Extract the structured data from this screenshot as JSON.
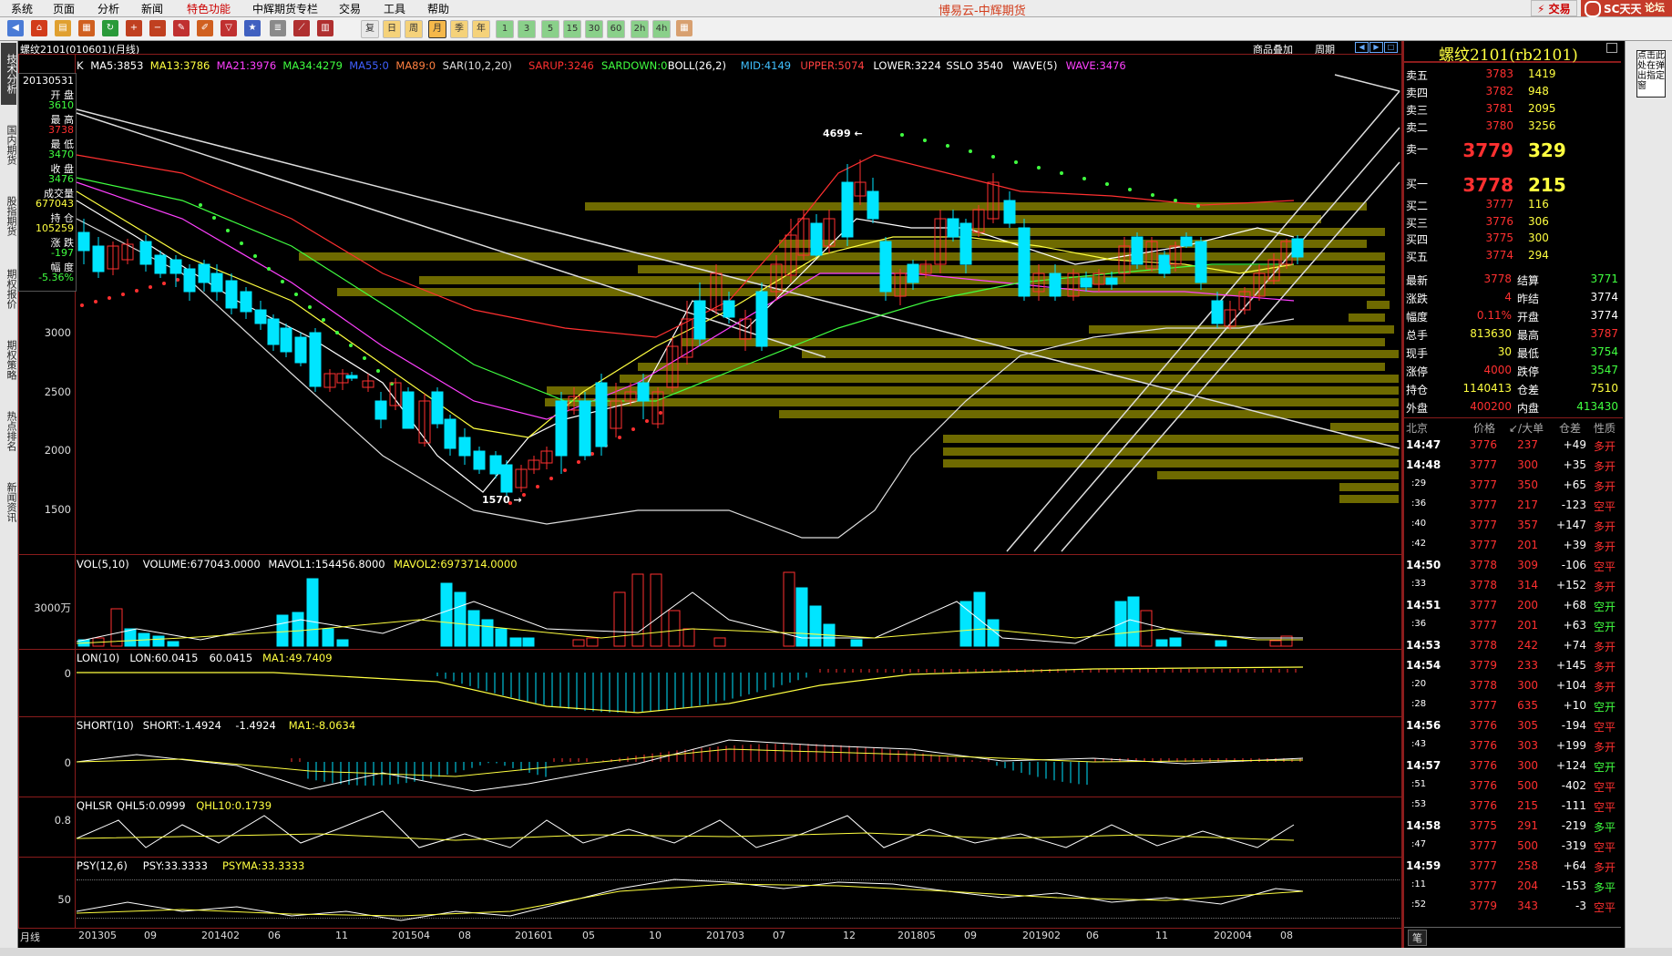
{
  "menu": {
    "items": [
      "系统",
      "页面",
      "分析",
      "新闻",
      "特色功能",
      "中辉期货专栏",
      "交易",
      "工具",
      "帮助"
    ],
    "title": "博易云-中辉期货",
    "trade_label": "交易",
    "brand": "论坛",
    "logo_text": "SC天天"
  },
  "toolbar": {
    "buttons": [
      "复",
      "日",
      "周",
      "月",
      "季",
      "年",
      "1",
      "3",
      "5",
      "15",
      "30",
      "60",
      "2h",
      "4h"
    ]
  },
  "sidebar": {
    "tabs": [
      "技术分析",
      "国内期货",
      "股指期货",
      "期权报价",
      "期权策略",
      "热点排名",
      "新闻资讯"
    ],
    "active": "技术分析"
  },
  "chart_header": {
    "symbol_line": "螺纹2101(010601)(月线)",
    "overlay_link": "商品叠加",
    "period_link": "周期"
  },
  "indicators": {
    "main": [
      {
        "text": "K",
        "color": "#ffffff"
      },
      {
        "text": "MA5:3853",
        "color": "#ffffff"
      },
      {
        "text": "MA13:3786",
        "color": "#ffff40"
      },
      {
        "text": "MA21:3976",
        "color": "#ff40ff"
      },
      {
        "text": "MA34:4279",
        "color": "#40ff40"
      },
      {
        "text": "MA55:0",
        "color": "#4060ff"
      },
      {
        "text": "MA89:0",
        "color": "#ff8040"
      },
      {
        "text": "SAR(10,2,20)",
        "color": "#dddddd"
      },
      {
        "text": "SARUP:3246",
        "color": "#ff3030"
      },
      {
        "text": "SARDOWN:0",
        "color": "#40ff40"
      },
      {
        "text": "BOLL(26,2)",
        "color": "#ffffff"
      },
      {
        "text": "MID:4149",
        "color": "#40c0ff"
      },
      {
        "text": "UPPER:5074",
        "color": "#ff4040"
      },
      {
        "text": "LOWER:3224",
        "color": "#ffffff"
      },
      {
        "text": "SSLO 3540",
        "color": "#ffffff"
      },
      {
        "text": "WAVE(5)",
        "color": "#ffffff"
      },
      {
        "text": "WAVE:3476",
        "color": "#ff40ff"
      }
    ],
    "vol": [
      {
        "text": "VOL(5,10)",
        "color": "#ffffff"
      },
      {
        "text": "VOLUME:677043.0000",
        "color": "#ffffff"
      },
      {
        "text": "MAVOL1:154456.8000",
        "color": "#ffffff"
      },
      {
        "text": "MAVOL2:6973714.0000",
        "color": "#ffff40"
      }
    ],
    "lon": [
      {
        "text": "LON(10)",
        "color": "#ffffff"
      },
      {
        "text": "LON:60.0415",
        "color": "#ffffff"
      },
      {
        "text": "60.0415",
        "color": "#ffffff"
      },
      {
        "text": "MA1:49.7409",
        "color": "#ffff40"
      }
    ],
    "short": [
      {
        "text": "SHORT(10)",
        "color": "#ffffff"
      },
      {
        "text": "SHORT:-1.4924",
        "color": "#ffffff"
      },
      {
        "text": "-1.4924",
        "color": "#ffffff"
      },
      {
        "text": "MA1:-8.0634",
        "color": "#ffff40"
      }
    ],
    "qhlsr": [
      {
        "text": "QHLSR",
        "color": "#ffffff"
      },
      {
        "text": "QHL5:0.0999",
        "color": "#ffffff"
      },
      {
        "text": "QHL10:0.1739",
        "color": "#ffff40"
      }
    ],
    "psy": [
      {
        "text": "PSY(12,6)",
        "color": "#ffffff"
      },
      {
        "text": "PSY:33.3333",
        "color": "#ffffff"
      },
      {
        "text": "PSYMA:33.3333",
        "color": "#ffff40"
      }
    ]
  },
  "infobox": {
    "date": "20130531",
    "open_label": "开 盘",
    "open": "3610",
    "high_label": "最 高",
    "high": "3738",
    "low_label": "最 低",
    "low": "3470",
    "close_label": "收 盘",
    "close": "3476",
    "vol_label": "成交量",
    "vol": "677043",
    "oi_label": "持 仓",
    "oi": "105259",
    "chg_label": "涨 跌",
    "chg": "-197",
    "amp_label": "幅 度",
    "amp": "-5.36%"
  },
  "y_labels": {
    "price": [
      "3000",
      "2500",
      "2000",
      "1500"
    ],
    "vol": "3000万",
    "lon": "0",
    "short": "0",
    "qhlsr": "0.8",
    "psy": "50"
  },
  "price_annotations": {
    "high": "4699",
    "low": "1570"
  },
  "x_labels": [
    "月线",
    "201305",
    "09",
    "201402",
    "06",
    "11",
    "201504",
    "08",
    "201601",
    "05",
    "10",
    "201703",
    "07",
    "12",
    "201805",
    "09",
    "201902",
    "06",
    "11",
    "202004",
    "08"
  ],
  "right_panel": {
    "title": "螺纹2101(rb2101)",
    "asks": [
      {
        "label": "卖五",
        "price": "3783",
        "vol": "1419"
      },
      {
        "label": "卖四",
        "price": "3782",
        "vol": "948"
      },
      {
        "label": "卖三",
        "price": "3781",
        "vol": "2095"
      },
      {
        "label": "卖二",
        "price": "3780",
        "vol": "3256"
      },
      {
        "label": "卖一",
        "price": "3779",
        "vol": "329"
      }
    ],
    "bids": [
      {
        "label": "买一",
        "price": "3778",
        "vol": "215"
      },
      {
        "label": "买二",
        "price": "3777",
        "vol": "116"
      },
      {
        "label": "买三",
        "price": "3776",
        "vol": "306"
      },
      {
        "label": "买四",
        "price": "3775",
        "vol": "300"
      },
      {
        "label": "买五",
        "price": "3774",
        "vol": "294"
      }
    ],
    "stats": [
      {
        "l1": "最新",
        "v1": "3778",
        "c1": "#ff3030",
        "l2": "结算",
        "v2": "3771",
        "c2": "#40ff40"
      },
      {
        "l1": "涨跌",
        "v1": "4",
        "c1": "#ff3030",
        "l2": "昨结",
        "v2": "3774",
        "c2": "#ffffff"
      },
      {
        "l1": "幅度",
        "v1": "0.11%",
        "c1": "#ff3030",
        "l2": "开盘",
        "v2": "3774",
        "c2": "#ffffff"
      },
      {
        "l1": "总手",
        "v1": "813630",
        "c1": "#ffff40",
        "l2": "最高",
        "v2": "3787",
        "c2": "#ff3030"
      },
      {
        "l1": "现手",
        "v1": "30",
        "c1": "#ffff40",
        "l2": "最低",
        "v2": "3754",
        "c2": "#40ff40"
      },
      {
        "l1": "涨停",
        "v1": "4000",
        "c1": "#ff3030",
        "l2": "跌停",
        "v2": "3547",
        "c2": "#40ff40"
      },
      {
        "l1": "持仓",
        "v1": "1140413",
        "c1": "#ffff40",
        "l2": "仓差",
        "v2": "7510",
        "c2": "#ffff40"
      },
      {
        "l1": "外盘",
        "v1": "400200",
        "c1": "#ff3030",
        "l2": "内盘",
        "v2": "413430",
        "c2": "#40ff40"
      }
    ],
    "ticks_header": {
      "time": "北京",
      "price": "价格",
      "vol": "↙/大单",
      "oi": "仓差",
      "nature": "性质"
    },
    "ticks": [
      {
        "t": "14:47",
        "p": "3776",
        "v": "237",
        "oi": "+49",
        "n": "多开",
        "nc": "#ff3030"
      },
      {
        "t": "14:48",
        "p": "3777",
        "v": "300",
        "oi": "+35",
        "n": "多开",
        "nc": "#ff3030"
      },
      {
        "t": ":29",
        "p": "3777",
        "v": "350",
        "oi": "+65",
        "n": "多开",
        "nc": "#ff3030"
      },
      {
        "t": ":36",
        "p": "3777",
        "v": "217",
        "oi": "-123",
        "n": "空平",
        "nc": "#ff3030"
      },
      {
        "t": ":40",
        "p": "3777",
        "v": "357",
        "oi": "+147",
        "n": "多开",
        "nc": "#ff3030"
      },
      {
        "t": ":42",
        "p": "3777",
        "v": "201",
        "oi": "+39",
        "n": "多开",
        "nc": "#ff3030"
      },
      {
        "t": "14:50",
        "p": "3778",
        "v": "309",
        "oi": "-106",
        "n": "空平",
        "nc": "#ff3030"
      },
      {
        "t": ":33",
        "p": "3778",
        "v": "314",
        "oi": "+152",
        "n": "多开",
        "nc": "#ff3030"
      },
      {
        "t": "14:51",
        "p": "3777",
        "v": "200",
        "oi": "+68",
        "n": "空开",
        "nc": "#40ff40"
      },
      {
        "t": ":36",
        "p": "3777",
        "v": "201",
        "oi": "+63",
        "n": "空开",
        "nc": "#40ff40"
      },
      {
        "t": "14:53",
        "p": "3778",
        "v": "242",
        "oi": "+74",
        "n": "多开",
        "nc": "#ff3030"
      },
      {
        "t": "14:54",
        "p": "3779",
        "v": "233",
        "oi": "+145",
        "n": "多开",
        "nc": "#ff3030"
      },
      {
        "t": ":20",
        "p": "3778",
        "v": "300",
        "oi": "+104",
        "n": "多开",
        "nc": "#ff3030"
      },
      {
        "t": ":28",
        "p": "3777",
        "v": "635",
        "oi": "+10",
        "n": "空开",
        "nc": "#40ff40"
      },
      {
        "t": "14:56",
        "p": "3776",
        "v": "305",
        "oi": "-194",
        "n": "空平",
        "nc": "#ff3030"
      },
      {
        "t": ":43",
        "p": "3776",
        "v": "303",
        "oi": "+199",
        "n": "多开",
        "nc": "#ff3030"
      },
      {
        "t": "14:57",
        "p": "3776",
        "v": "300",
        "oi": "+124",
        "n": "空开",
        "nc": "#40ff40"
      },
      {
        "t": ":51",
        "p": "3776",
        "v": "500",
        "oi": "-402",
        "n": "空平",
        "nc": "#ff3030"
      },
      {
        "t": ":53",
        "p": "3776",
        "v": "215",
        "oi": "-111",
        "n": "空平",
        "nc": "#ff3030"
      },
      {
        "t": "14:58",
        "p": "3775",
        "v": "291",
        "oi": "-219",
        "n": "多平",
        "nc": "#40ff40"
      },
      {
        "t": ":47",
        "p": "3777",
        "v": "500",
        "oi": "-319",
        "n": "空平",
        "nc": "#ff3030"
      },
      {
        "t": "14:59",
        "p": "3777",
        "v": "258",
        "oi": "+64",
        "n": "多开",
        "nc": "#ff3030"
      },
      {
        "t": ":11",
        "p": "3777",
        "v": "204",
        "oi": "-153",
        "n": "多平",
        "nc": "#40ff40"
      },
      {
        "t": ":52",
        "p": "3779",
        "v": "343",
        "oi": "-3",
        "n": "空平",
        "nc": "#ff3030"
      }
    ],
    "bottom_tab": "笔"
  },
  "far_right": {
    "text": "点击此处在弹出指定窗"
  },
  "colors": {
    "up": "#ff3030",
    "down": "#00e5ff",
    "ma5": "#ffffff",
    "ma13": "#ffff40",
    "ma21": "#ff40ff",
    "ma34": "#40ff40",
    "volume_profile": "#6e6a00"
  }
}
